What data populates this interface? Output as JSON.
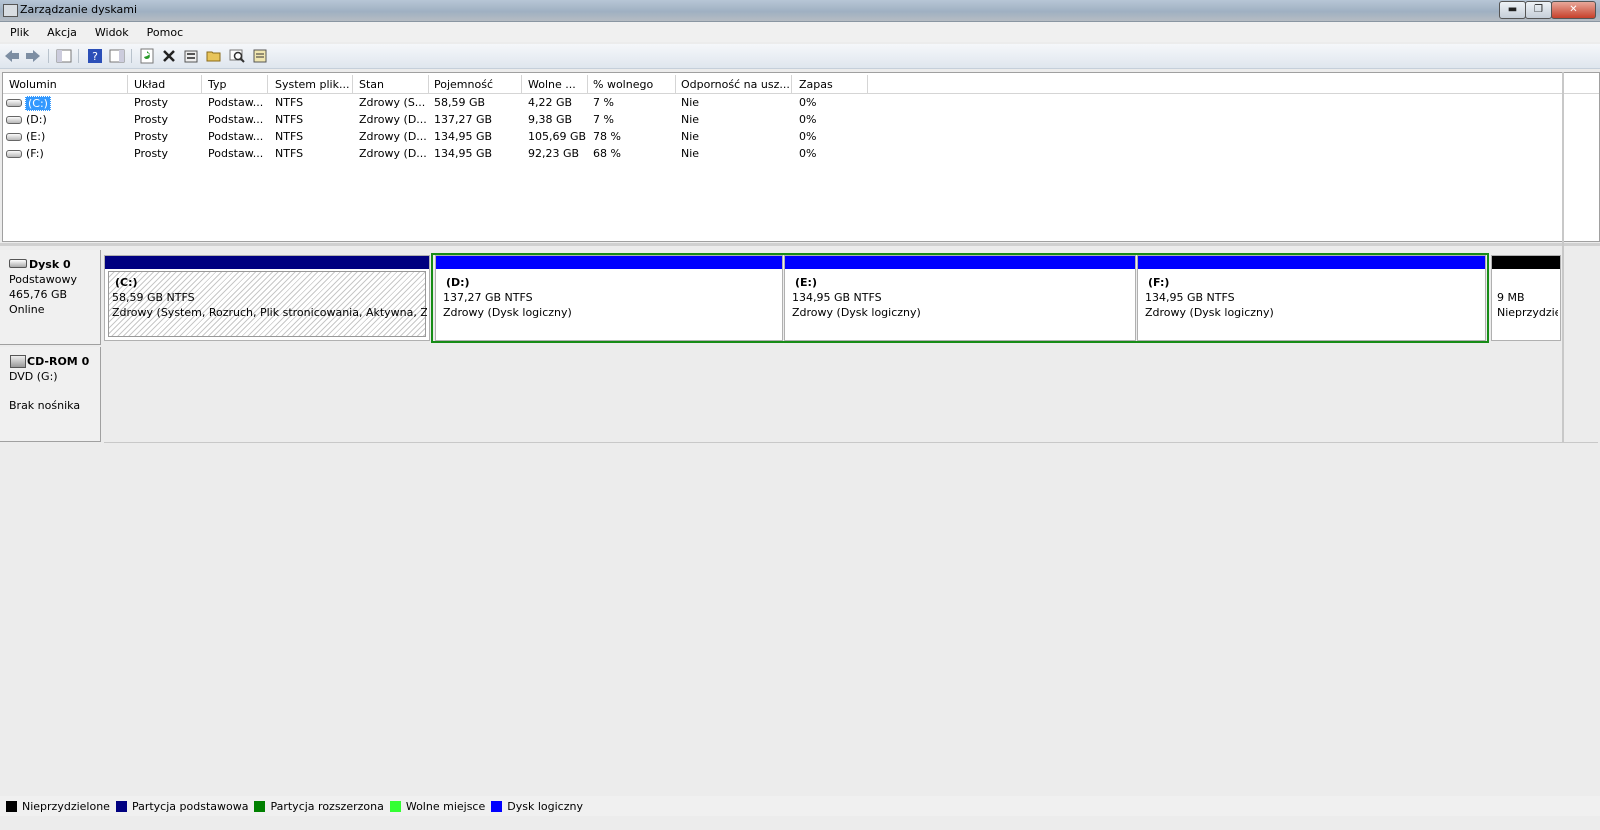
{
  "window": {
    "title": "Zarządzanie dyskami",
    "min_glyph": "▬",
    "max_glyph": "❐",
    "close_glyph": "✕"
  },
  "menu": [
    "Plik",
    "Akcja",
    "Widok",
    "Pomoc"
  ],
  "toolbar_icons": [
    "back-arrow-icon",
    "forward-arrow-icon",
    "show-hide-console-icon",
    "help-icon",
    "properties-pane-icon",
    "refresh-icon",
    "delete-icon",
    "properties-icon",
    "open-icon",
    "explore-icon",
    "rescan-icon"
  ],
  "volume_table": {
    "headers": [
      "Wolumin",
      "Układ",
      "Typ",
      "System plik...",
      "Stan",
      "Pojemność",
      "Wolne ...",
      "% wolnego",
      "Odporność na usz...",
      "Zapas"
    ],
    "rows": [
      [
        "(C:)",
        "Prosty",
        "Podstaw...",
        "NTFS",
        "Zdrowy (S...",
        "58,59 GB",
        "4,22 GB",
        "7 %",
        "Nie",
        "0%"
      ],
      [
        "(D:)",
        "Prosty",
        "Podstaw...",
        "NTFS",
        "Zdrowy (D...",
        "137,27 GB",
        "9,38 GB",
        "7 %",
        "Nie",
        "0%"
      ],
      [
        "(E:)",
        "Prosty",
        "Podstaw...",
        "NTFS",
        "Zdrowy (D...",
        "134,95 GB",
        "105,69 GB",
        "78 %",
        "Nie",
        "0%"
      ],
      [
        "(F:)",
        "Prosty",
        "Podstaw...",
        "NTFS",
        "Zdrowy (D...",
        "134,95 GB",
        "92,23 GB",
        "68 %",
        "Nie",
        "0%"
      ]
    ]
  },
  "disk0": {
    "title": "Dysk 0",
    "type": "Podstawowy",
    "size": "465,76 GB",
    "status": "Online",
    "partitions": [
      {
        "name": "(C:)",
        "size": "58,59 GB NTFS",
        "status": "Zdrowy (System, Rozruch, Plik stronicowania, Aktywna, Zrzut awaryjny, Partycja podstawowa)"
      },
      {
        "name": "(D:)",
        "size": "137,27 GB NTFS",
        "status": "Zdrowy (Dysk logiczny)"
      },
      {
        "name": "(E:)",
        "size": "134,95 GB NTFS",
        "status": "Zdrowy (Dysk logiczny)"
      },
      {
        "name": "(F:)",
        "size": "134,95 GB NTFS",
        "status": "Zdrowy (Dysk logiczny)"
      }
    ],
    "unallocated": {
      "size": "9 MB",
      "label": "Nieprzydzielone"
    }
  },
  "cdrom0": {
    "title": "CD-ROM 0",
    "drive": "DVD (G:)",
    "status": "Brak nośnika"
  },
  "legend": [
    {
      "label": "Nieprzydzielone",
      "color": "#000000"
    },
    {
      "label": "Partycja podstawowa",
      "color": "#000080"
    },
    {
      "label": "Partycja rozszerzona",
      "color": "#008000"
    },
    {
      "label": "Wolne miejsce",
      "color": "#33ff33"
    },
    {
      "label": "Dysk logiczny",
      "color": "#0000ff"
    }
  ]
}
